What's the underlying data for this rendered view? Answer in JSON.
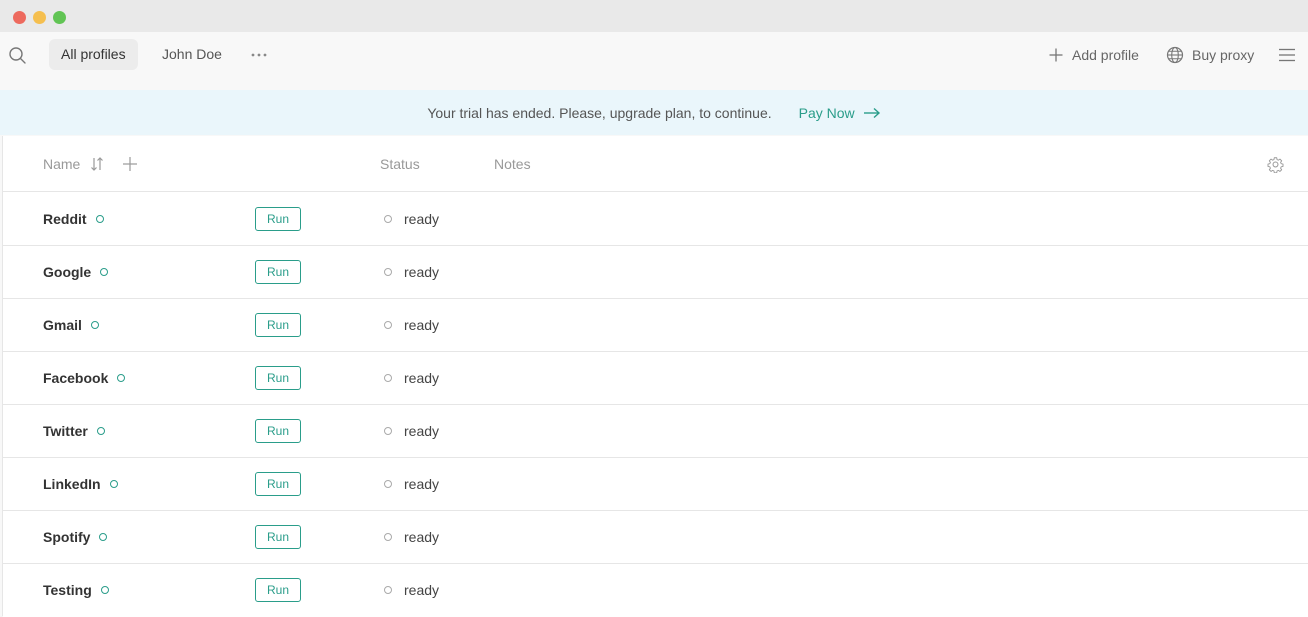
{
  "toolbar": {
    "tabs": [
      {
        "label": "All profiles"
      },
      {
        "label": "John Doe"
      }
    ],
    "add_profile_label": "Add profile",
    "buy_proxy_label": "Buy proxy"
  },
  "banner": {
    "message": "Your trial has ended. Please, upgrade plan, to continue.",
    "link_label": "Pay Now"
  },
  "table": {
    "columns": {
      "name": "Name",
      "status": "Status",
      "notes": "Notes"
    },
    "run_label": "Run",
    "rows": [
      {
        "name": "Reddit",
        "status": "ready"
      },
      {
        "name": "Google",
        "status": "ready"
      },
      {
        "name": "Gmail",
        "status": "ready"
      },
      {
        "name": "Facebook",
        "status": "ready"
      },
      {
        "name": "Twitter",
        "status": "ready"
      },
      {
        "name": "LinkedIn",
        "status": "ready"
      },
      {
        "name": "Spotify",
        "status": "ready"
      },
      {
        "name": "Testing",
        "status": "ready"
      }
    ]
  },
  "colors": {
    "accent": "#2a9d8a",
    "banner_bg": "#eaf6fb"
  }
}
